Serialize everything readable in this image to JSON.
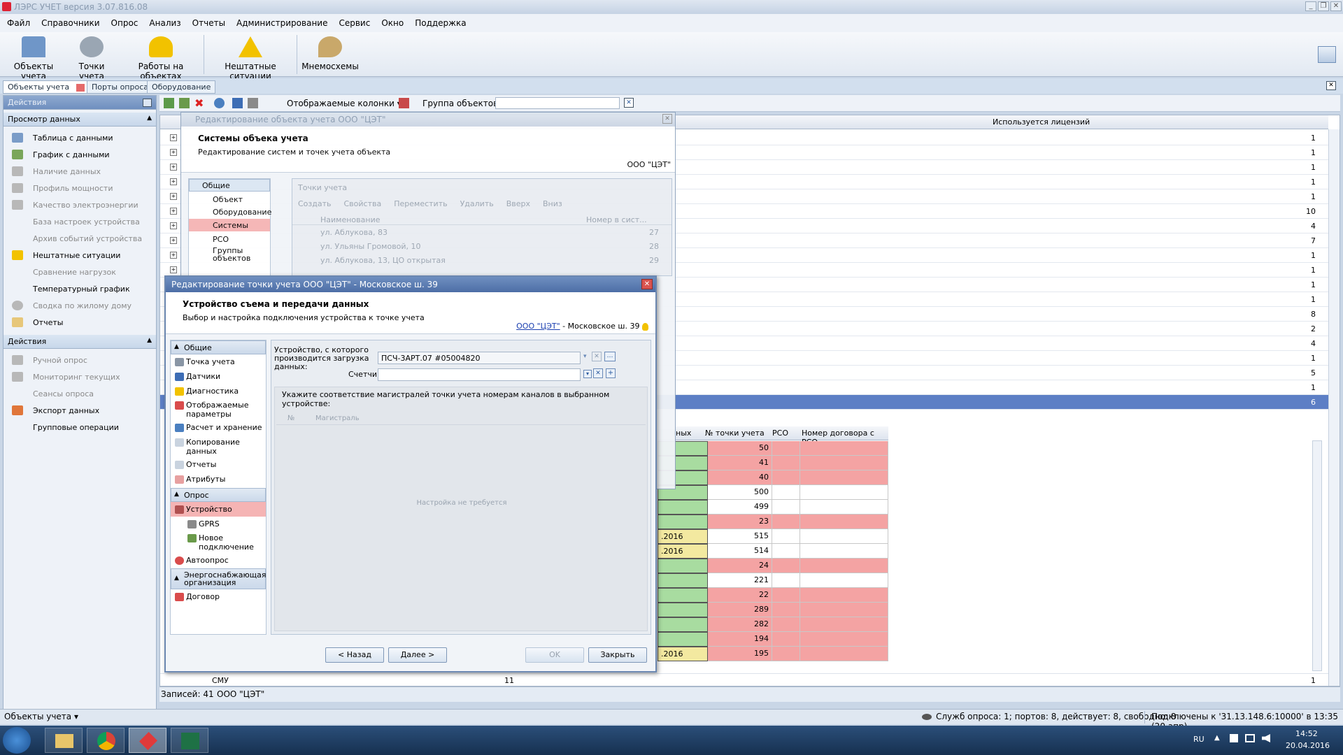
{
  "window": {
    "title": "ЛЭРС УЧЕТ версия 3.07.816.08"
  },
  "menu": [
    "Файл",
    "Справочники",
    "Опрос",
    "Анализ",
    "Отчеты",
    "Администрирование",
    "Сервис",
    "Окно",
    "Поддержка"
  ],
  "ribbon": {
    "objects": "Объекты учета",
    "points": "Точки учета",
    "works": "Работы на объектах",
    "emergency": "Нештатные ситуации",
    "schemes": "Мнемосхемы"
  },
  "tabs": {
    "t1": "Объекты учета",
    "t2": "Порты опроса",
    "t3": "Оборудование"
  },
  "left": {
    "actions_title": "Действия",
    "view_head": "Просмотр данных",
    "view_items": [
      "Таблица с данными",
      "График с данными",
      "Наличие данных",
      "Профиль мощности",
      "Качество электроэнергии",
      "База настроек устройства",
      "Архив событий устройства",
      "Нештатные ситуации",
      "Сравнение нагрузок",
      "Температурный график",
      "Сводка по жилому дому",
      "Отчеты"
    ],
    "actions_head": "Действия",
    "action_items": [
      "Ручной опрос",
      "Мониторинг текущих",
      "Сеансы опроса",
      "Экспорт данных",
      "Групповые операции"
    ]
  },
  "toolbar": {
    "columns": "Отображаемые колонки",
    "group_label": "Группа объектов:"
  },
  "grid": {
    "header_license": "Используется лицензий",
    "values": [
      "1",
      "1",
      "1",
      "1",
      "1",
      "10",
      "4",
      "7",
      "1",
      "1",
      "1",
      "1",
      "8",
      "2",
      "4",
      "1",
      "5",
      "1",
      "6"
    ],
    "bottom_row": {
      "name": "СМУ",
      "num": "11",
      "val": "1"
    },
    "lower_headers": {
      "fragment": "ных",
      "point_no": "№ точки учета",
      "rso": "РСО",
      "contract": "Номер договора с РСО"
    },
    "lower_rows": [
      {
        "date": "",
        "no": "50",
        "color": "red"
      },
      {
        "date": "",
        "no": "41",
        "color": "red"
      },
      {
        "date": "",
        "no": "40",
        "color": "red"
      },
      {
        "date": "",
        "no": "500",
        "color": "white"
      },
      {
        "date": "",
        "no": "499",
        "color": "white"
      },
      {
        "date": "",
        "no": "23",
        "color": "red"
      },
      {
        "date": ".2016",
        "no": "515",
        "color": "white"
      },
      {
        "date": ".2016",
        "no": "514",
        "color": "white"
      },
      {
        "date": "",
        "no": "24",
        "color": "red"
      },
      {
        "date": "",
        "no": "221",
        "color": "white"
      },
      {
        "date": "",
        "no": "22",
        "color": "red"
      },
      {
        "date": "",
        "no": "289",
        "color": "red"
      },
      {
        "date": "",
        "no": "282",
        "color": "red"
      },
      {
        "date": "",
        "no": "194",
        "color": "red"
      },
      {
        "date": ".2016",
        "no": "195",
        "color": "red"
      }
    ]
  },
  "records": {
    "count": "Записей: 41",
    "org": "ООО \"ЦЭТ\""
  },
  "bg_dialog": {
    "title": "Редактирование объекта учета ООО \"ЦЭТ\"",
    "heading": "Системы объека учета",
    "sub": "Редактирование систем и точек учета объекта",
    "org": "ООО \"ЦЭТ\"",
    "tree": [
      "Общие",
      "Объект",
      "Оборудование",
      "Системы",
      "РСО",
      "Группы объектов"
    ],
    "points_label": "Точки учета",
    "tb": [
      "Создать",
      "Свойства",
      "Переместить",
      "Удалить",
      "Вверх",
      "Вниз"
    ],
    "col_name": "Наименование",
    "col_num": "Номер в сист...",
    "rows": [
      {
        "name": "ул. Аблукова, 83",
        "num": "27"
      },
      {
        "name": "ул. Ульяны Громовой, 10",
        "num": "28"
      },
      {
        "name": "ул. Аблукова, 13, ЦО открытая",
        "num": "29"
      }
    ]
  },
  "dialog": {
    "title": "Редактирование точки учета ООО \"ЦЭТ\" - Московское ш. 39",
    "heading": "Устройство съема и передачи данных",
    "sub": "Выбор и настройка подключения устройства к точке учета",
    "org_link": "ООО \"ЦЭТ\"",
    "address": " - Московское ш. 39",
    "tree": {
      "g1": "Общие",
      "g1_items": [
        "Точка учета",
        "Датчики",
        "Диагностика",
        "Отображаемые параметры",
        "Расчет и хранение",
        "Копирование данных",
        "Отчеты",
        "Атрибуты"
      ],
      "g2": "Опрос",
      "g2_items": [
        "Устройство",
        "GPRS",
        "Новое подключение",
        "Автоопрос"
      ],
      "g3": "Энергоснабжающая организация",
      "g3_items": [
        "Договор"
      ]
    },
    "device_label": "Устройство, с которого производится загрузка данных:",
    "device_value": "ПСЧ-3АРТ.07 #05004820",
    "meter_label": "Счетчик:",
    "meter_value": "",
    "mapping_label": "Укажите соответствие магистралей точки учета номерам каналов в выбранном устройстве:",
    "col_no": "№",
    "col_main": "Магистраль",
    "empty": "Настройка не требуется",
    "buttons": {
      "back": "< Назад",
      "next": "Далее >",
      "ok": "OK",
      "close": "Закрыть"
    }
  },
  "status": {
    "left": "Объекты учета",
    "svc": "Служб опроса: 1; портов: 8, действует: 8, свободно: 8",
    "conn": "Подключены к '31.13.148.6:10000' в 13:35 (20 апр)"
  },
  "taskbar": {
    "lang": "RU",
    "time": "14:52",
    "date": "20.04.2016"
  }
}
